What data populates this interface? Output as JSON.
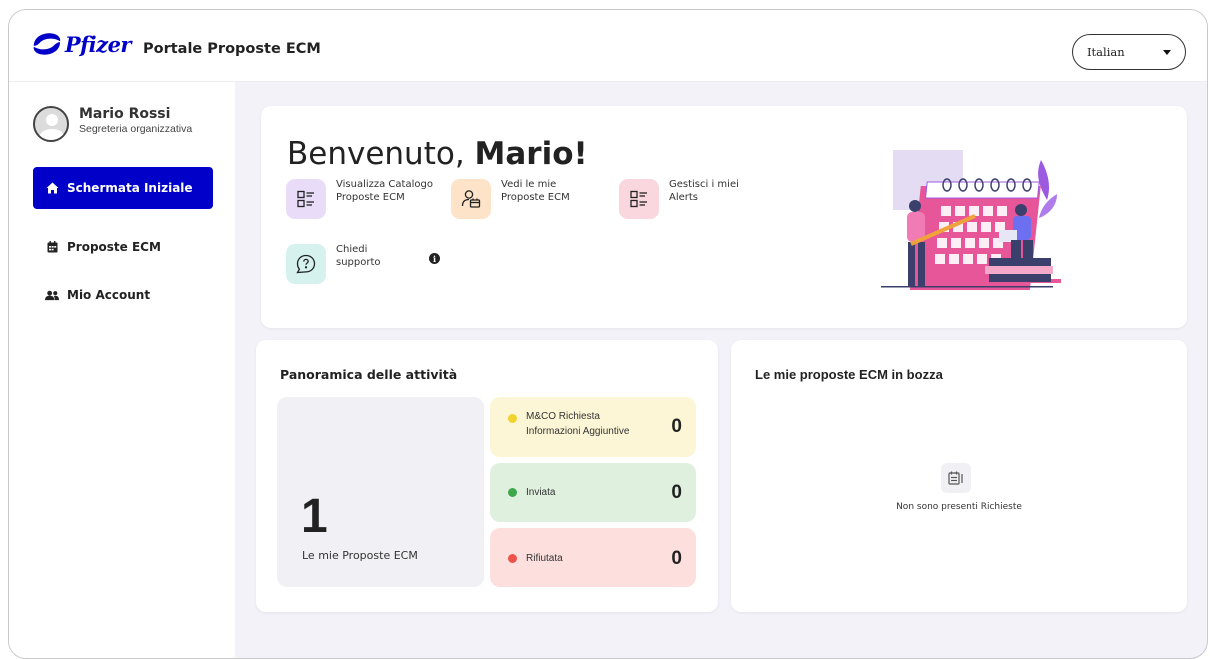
{
  "header": {
    "logo_text": "Pfizer",
    "portal_title": "Portale Proposte ECM",
    "language": "Italian"
  },
  "user": {
    "name": "Mario Rossi",
    "role": "Segreteria organizzativa"
  },
  "sidebar": {
    "items": [
      {
        "label": "Schermata Iniziale",
        "icon": "home-icon",
        "active": true
      },
      {
        "label": "Proposte ECM",
        "icon": "calendar-icon",
        "active": false
      },
      {
        "label": "Mio Account",
        "icon": "users-icon",
        "active": false
      }
    ]
  },
  "welcome": {
    "greeting": "Benvenuto, ",
    "name": "Mario!",
    "actions": [
      {
        "label": "Visualizza Catalogo Proposte ECM",
        "icon": "catalog-list-icon",
        "color": "#e9dcf8"
      },
      {
        "label": "Vedi le mie Proposte ECM",
        "icon": "user-folder-icon",
        "color": "#fde3c8"
      },
      {
        "label": "Gestisci i miei Alerts",
        "icon": "alert-list-icon",
        "color": "#fad6de"
      },
      {
        "label": "Chiedi supporto",
        "icon": "help-icon",
        "color": "#d5f2ef"
      }
    ],
    "info_glyph": "i"
  },
  "overview": {
    "title": "Panoramica delle attività",
    "total_value": "1",
    "total_label": "Le mie Proposte ECM",
    "statuses": [
      {
        "label": "M&CO Richiesta Informazioni Aggiuntive",
        "value": "0",
        "dot": "#f2d22f",
        "bg": "#fdf6d6"
      },
      {
        "label": "Inviata",
        "value": "0",
        "dot": "#3fa84a",
        "bg": "#dff0df"
      },
      {
        "label": "Rifiutata",
        "value": "0",
        "dot": "#ee5349",
        "bg": "#fde0de"
      }
    ]
  },
  "drafts": {
    "title": "Le mie proposte ECM in bozza",
    "empty_text": "Non sono presenti Richieste"
  },
  "colors": {
    "brand": "#0000c9",
    "background": "#f2f2f8"
  }
}
